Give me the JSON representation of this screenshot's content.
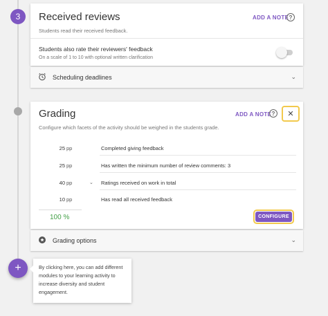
{
  "step_number": "3",
  "received_reviews": {
    "title": "Received reviews",
    "add_note": "ADD A NOTE",
    "description": "Students read their received feedback.",
    "option_title": "Students also rate their reviewers' feedback",
    "option_desc": "On a scale of 1 to 10 with optional written clarification",
    "toggle_on": false
  },
  "scheduling": {
    "label": "Scheduling deadlines"
  },
  "grading": {
    "title": "Grading",
    "add_note": "ADD A NOTE",
    "description": "Configure which facets of the activity should be weighed in the students grade.",
    "rows": [
      {
        "value": "25",
        "unit": "pp",
        "label": "Completed giving feedback",
        "expandable": false
      },
      {
        "value": "25",
        "unit": "pp",
        "label": "Has written the minimum number of review comments: 3",
        "expandable": false
      },
      {
        "value": "40",
        "unit": "pp",
        "label": "Ratings received on work in total",
        "expandable": true
      },
      {
        "value": "10",
        "unit": "pp",
        "label": "Has read all received feedback",
        "expandable": false
      }
    ],
    "total": "100 %",
    "configure": "CONFIGURE"
  },
  "grading_options": {
    "label": "Grading options"
  },
  "fab": {
    "symbol": "+"
  },
  "tooltip": {
    "text": "By clicking here, you can add different modules to your learning activity to increase diversity and student engagement."
  },
  "colors": {
    "accent": "#7e57c2",
    "highlight": "#f2c94c",
    "total_green": "#43a047"
  },
  "icons": {
    "help": "help-circle-icon",
    "close": "close-icon",
    "scheduling": "alarm-clock-icon",
    "grading_options": "settings-badge-icon",
    "chevron": "chevron-down-icon"
  }
}
